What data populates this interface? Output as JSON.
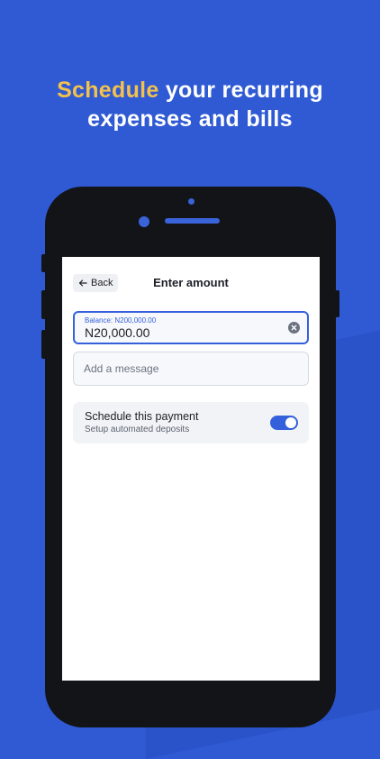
{
  "headline": {
    "highlight": "Schedule",
    "line1_rest": " your recurring",
    "line2": "expenses and bills"
  },
  "screen": {
    "back_label": "Back",
    "title": "Enter amount",
    "amount": {
      "balance_label": "Balance: N200,000.00",
      "value": "N20,000.00"
    },
    "message": {
      "placeholder": "Add a message",
      "value": ""
    },
    "schedule": {
      "title": "Schedule this payment",
      "subtitle": "Setup automated deposits",
      "enabled": true
    }
  },
  "colors": {
    "background": "#2f5ad3",
    "highlight": "#f2c14e",
    "accent": "#3560dc"
  },
  "icons": {
    "back": "arrow-left-icon",
    "clear": "clear-circle-x-icon"
  }
}
